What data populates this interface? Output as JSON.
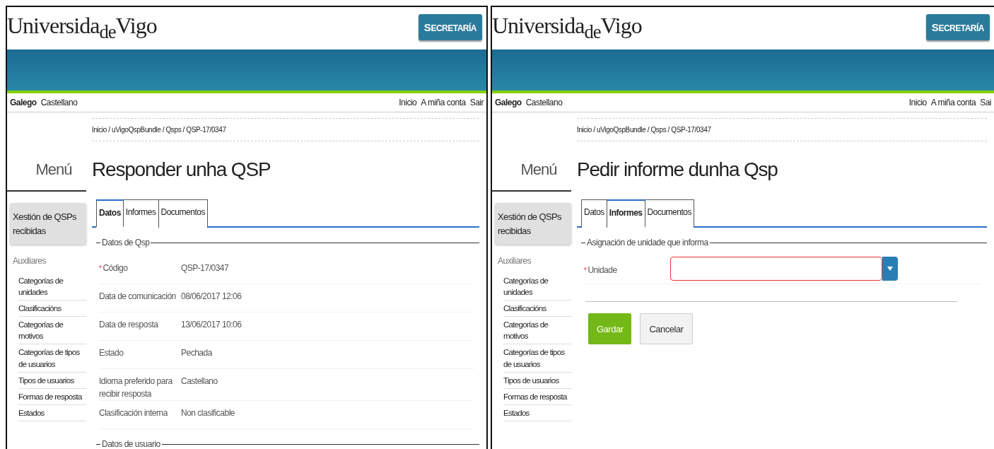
{
  "panels": [
    {
      "logo": "Universida$_{de}$Vigo",
      "header_button": "SECRETARÍA",
      "languages": [
        {
          "label": "Galego",
          "selected": true
        },
        {
          "label": "Castellano",
          "selected": false
        }
      ],
      "user_links": [
        "Inicio",
        "A miña conta",
        "Sair"
      ],
      "breadcrumb": "Inicio / uVigoQspBundle / Qsps / QSP-17/0347",
      "menu": {
        "title": "Menú",
        "items": [
          {
            "label": "Xestión de QSPs recibidas",
            "selected": true
          }
        ],
        "section": "Auxiliares",
        "subitems": [
          "Categorías de unidades",
          "Clasificacións",
          "Categorías de motivos",
          "Categorías de tipos de usuarios",
          "Tipos de usuarios",
          "Formas de resposta",
          "Estados"
        ]
      },
      "title": "Responder unha QSP",
      "tabs": [
        {
          "label": "Datos",
          "selected": true
        },
        {
          "label": "Informes",
          "selected": false
        },
        {
          "label": "Documentos",
          "selected": false
        }
      ],
      "content": {
        "kind": "details",
        "fieldsets": [
          {
            "legend": "Datos de Qsp",
            "rows": [
              {
                "label": "Código",
                "required_mark": "*",
                "value": "QSP-17/0347"
              },
              {
                "label": "Data de comunicación",
                "value": "08/06/2017 12:06"
              },
              {
                "label": "Data de resposta",
                "value": "13/06/2017 10:06"
              },
              {
                "label": "Estado",
                "value": "Pechada"
              },
              {
                "label": "Idioma preferido para recibir resposta",
                "value": "Castellano"
              },
              {
                "label": "Clasificación interna",
                "value": "Non clasificable"
              }
            ]
          },
          {
            "legend": "Datos de usuario"
          }
        ]
      }
    },
    {
      "logo": "Universida$_{de}$Vigo",
      "header_button": "SECRETARÍA",
      "languages": [
        {
          "label": "Galego",
          "selected": true
        },
        {
          "label": "Castellano",
          "selected": false
        }
      ],
      "user_links": [
        "Inicio",
        "A miña conta",
        "Sai"
      ],
      "breadcrumb": "Inicio / uVigoQspBundle / Qsps / QSP-17/0347",
      "menu": {
        "title": "Menú",
        "items": [
          {
            "label": "Xestión de QSPs recibidas",
            "selected": true
          }
        ],
        "section": "Auxiliares",
        "subitems": [
          "Categorías de unidades",
          "Clasificacións",
          "Categorías de motivos",
          "Categorías de tipos de usuarios",
          "Tipos de usuarios",
          "Formas de resposta",
          "Estados"
        ]
      },
      "title": "Pedir informe dunha Qsp",
      "tabs": [
        {
          "label": "Datos",
          "selected": false
        },
        {
          "label": "Informes",
          "selected": true
        },
        {
          "label": "Documentos",
          "selected": false
        }
      ],
      "content": {
        "kind": "form",
        "legend": "Asignación de unidade que informa",
        "field": {
          "label": "Unidade",
          "required_mark": "*",
          "invalid": true
        },
        "buttons": [
          {
            "label": "Gardar",
            "kind": "primary"
          },
          {
            "label": "Cancelar",
            "kind": "default"
          }
        ]
      }
    }
  ]
}
